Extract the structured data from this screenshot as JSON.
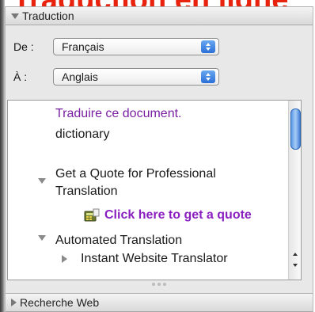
{
  "top_heading": "Traduction en ligne",
  "translation": {
    "header_label": "Traduction",
    "from_label": "De :",
    "from_value": "Français",
    "to_label": "À :",
    "to_value": "Anglais"
  },
  "results": {
    "translate_doc": "Traduire ce document.",
    "dictionary": "dictionary",
    "pro_heading": "Get a Quote for Professional Translation",
    "quote_link": "Click here to get a quote",
    "auto_heading": "Automated Translation",
    "website_translator": "Instant Website Translator"
  },
  "web_search": {
    "header_label": "Recherche Web"
  },
  "colors": {
    "link_purple": "#7a1fa2",
    "quote_purple": "#8a1fc0",
    "heading_red": "#e8220c"
  }
}
